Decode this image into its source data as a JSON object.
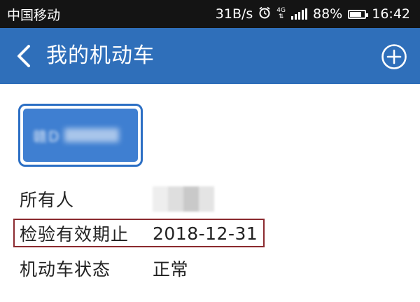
{
  "status_bar": {
    "carrier": "中国移动",
    "net_speed": "31B/s",
    "network_type": "4G",
    "battery": "88%",
    "battery_level": 0.88,
    "time": "16:42",
    "icons": [
      "alarm-clock-icon",
      "signal-icon",
      "battery-icon"
    ]
  },
  "header": {
    "title": "我的机动车",
    "back_icon": "chevron-left-icon",
    "add_icon": "plus-circle-icon",
    "background_color": "#2f6fba"
  },
  "vehicle": {
    "plate_text": "赣D",
    "plate_color": "#3f7fd1",
    "rows": [
      {
        "label": "所有人",
        "value": ""
      },
      {
        "label": "检验有效期止",
        "value": "2018-12-31"
      },
      {
        "label": "机动车状态",
        "value": "正常"
      }
    ]
  },
  "highlight_color": "#8b2a2f"
}
